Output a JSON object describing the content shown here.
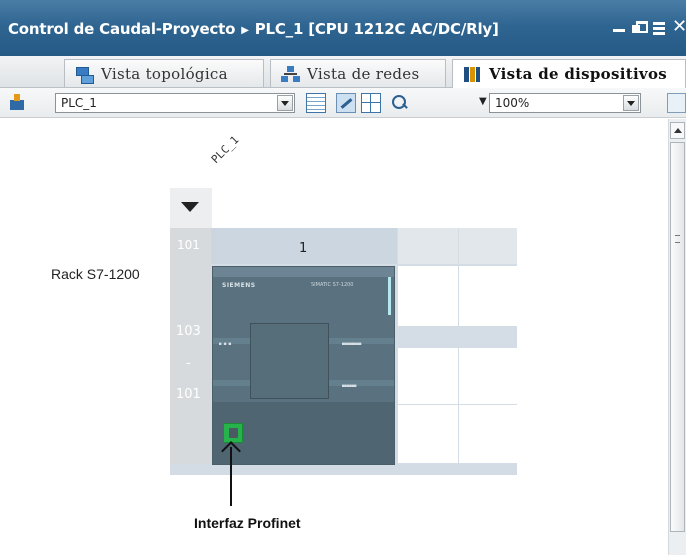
{
  "window": {
    "project": "Control de Caudal-Proyecto",
    "separator": "▶",
    "device": "PLC_1 [CPU 1212C AC/DC/Rly]"
  },
  "tabs": [
    {
      "label": "Vista topológica",
      "icon": "topology-icon",
      "active": false
    },
    {
      "label": "Vista de redes",
      "icon": "network-icon",
      "active": false
    },
    {
      "label": "Vista de dispositivos",
      "icon": "device-icon",
      "active": true
    }
  ],
  "toolbar": {
    "device_select": "PLC_1",
    "zoom": "100%"
  },
  "canvas": {
    "plc_name": "PLC_1",
    "rack_label": "Rack S7-1200",
    "slot_101_header": "101",
    "slot_1_header": "1",
    "slot_103": "103",
    "slot_dash": "-",
    "slot_101": "101",
    "cpu_brand": "SIEMENS",
    "cpu_model": "SIMATIC S7-1200",
    "annotation": "Interfaz Profinet"
  },
  "colors": {
    "title_bar": "#2f6591",
    "cpu_body": "#5a7280",
    "profinet_port": "#27b34b",
    "rack": "#d4dde6"
  }
}
